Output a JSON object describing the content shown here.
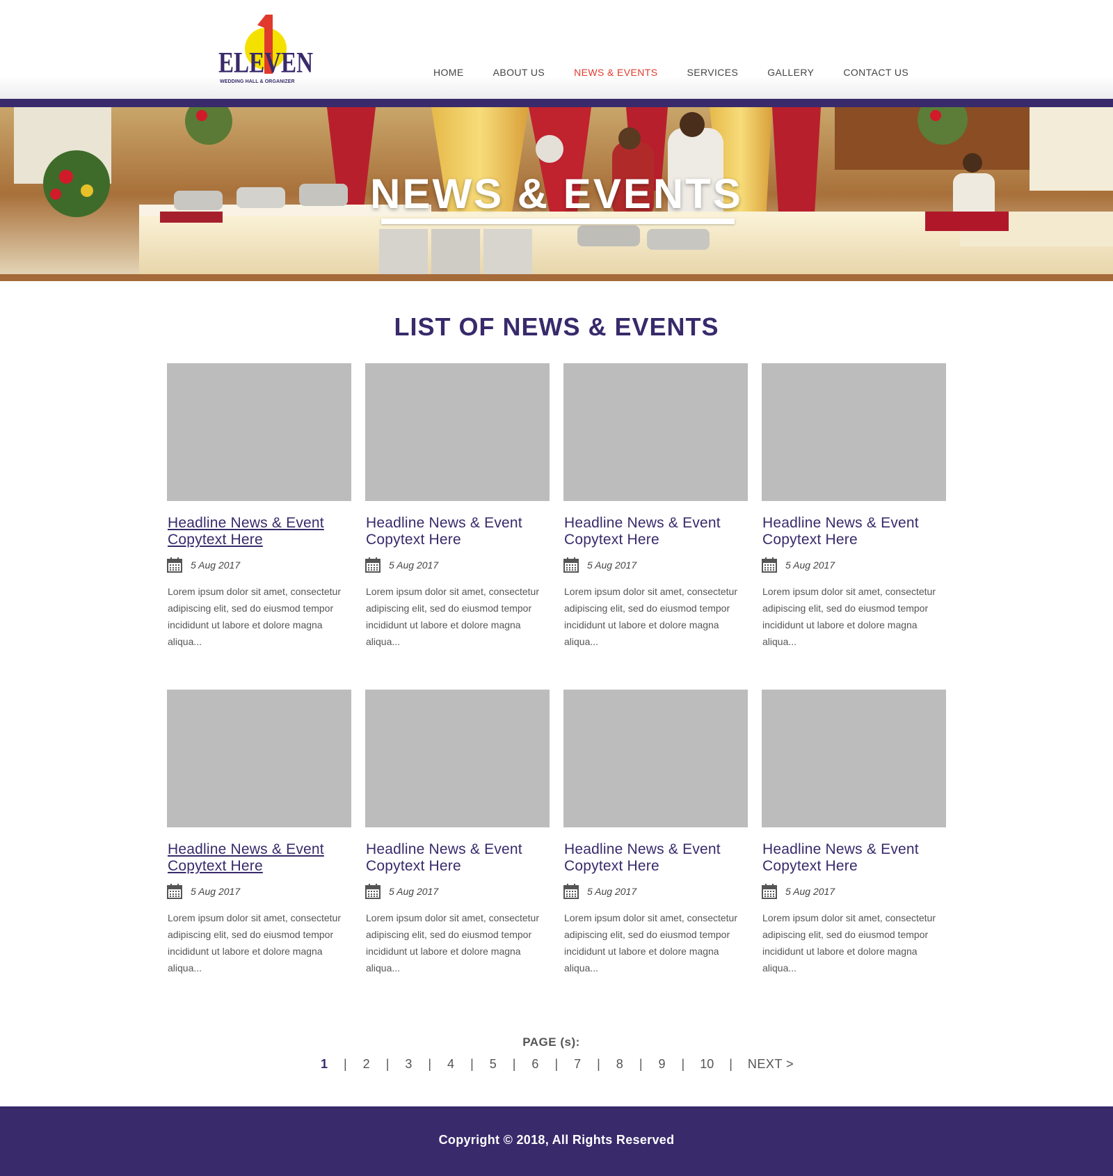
{
  "brand": {
    "logo_word": "ELEVEN",
    "logo_digit": "1",
    "tagline": "WEDDING HALL & ORGANIZER",
    "colors": {
      "primary": "#382a6b",
      "accent": "#e03a2c",
      "sun": "#f5e100"
    }
  },
  "nav": {
    "items": [
      {
        "label": "HOME"
      },
      {
        "label": "ABOUT US"
      },
      {
        "label": "NEWS & EVENTS",
        "active": true
      },
      {
        "label": "SERVICES"
      },
      {
        "label": "GALLERY"
      },
      {
        "label": "CONTACT US"
      }
    ]
  },
  "banner": {
    "title": "NEWS & EVENTS"
  },
  "section": {
    "title": "LIST OF NEWS & EVENTS"
  },
  "cards": [
    {
      "headline": "Headline News & Event Copytext Here",
      "date": "5 Aug 2017",
      "excerpt": "Lorem ipsum dolor sit amet, consectetur adipiscing elit, sed do eiusmod tempor incididunt ut labore et dolore magna aliqua..."
    },
    {
      "headline": "Headline News & Event Copytext Here",
      "date": "5 Aug 2017",
      "excerpt": "Lorem ipsum dolor sit amet, consectetur adipiscing elit, sed do eiusmod tempor incididunt ut labore et dolore magna aliqua..."
    },
    {
      "headline": "Headline News & Event Copytext Here",
      "date": "5 Aug 2017",
      "excerpt": "Lorem ipsum dolor sit amet, consectetur adipiscing elit, sed do eiusmod tempor incididunt ut labore et dolore magna aliqua..."
    },
    {
      "headline": "Headline News & Event Copytext Here",
      "date": "5 Aug 2017",
      "excerpt": "Lorem ipsum dolor sit amet, consectetur adipiscing elit, sed do eiusmod tempor incididunt ut labore et dolore magna aliqua..."
    },
    {
      "headline": "Headline News & Event Copytext Here",
      "date": "5 Aug 2017",
      "excerpt": "Lorem ipsum dolor sit amet, consectetur adipiscing elit, sed do eiusmod tempor incididunt ut labore et dolore magna aliqua..."
    },
    {
      "headline": "Headline News & Event Copytext Here",
      "date": "5 Aug 2017",
      "excerpt": "Lorem ipsum dolor sit amet, consectetur adipiscing elit, sed do eiusmod tempor incididunt ut labore et dolore magna aliqua..."
    },
    {
      "headline": "Headline News & Event Copytext Here",
      "date": "5 Aug 2017",
      "excerpt": "Lorem ipsum dolor sit amet, consectetur adipiscing elit, sed do eiusmod tempor incididunt ut labore et dolore magna aliqua..."
    },
    {
      "headline": "Headline News & Event Copytext Here",
      "date": "5 Aug 2017",
      "excerpt": "Lorem ipsum dolor sit amet, consectetur adipiscing elit, sed do eiusmod tempor incididunt ut labore et dolore magna aliqua..."
    }
  ],
  "pagination": {
    "label": "PAGE (s):",
    "pages": [
      "1",
      "2",
      "3",
      "4",
      "5",
      "6",
      "7",
      "8",
      "9",
      "10"
    ],
    "current": "1",
    "separator": "|",
    "next_label": "NEXT >"
  },
  "footer": {
    "copyright": "Copyright © 2018, All Rights Reserved"
  },
  "icons": {
    "date": "calendar-icon"
  }
}
